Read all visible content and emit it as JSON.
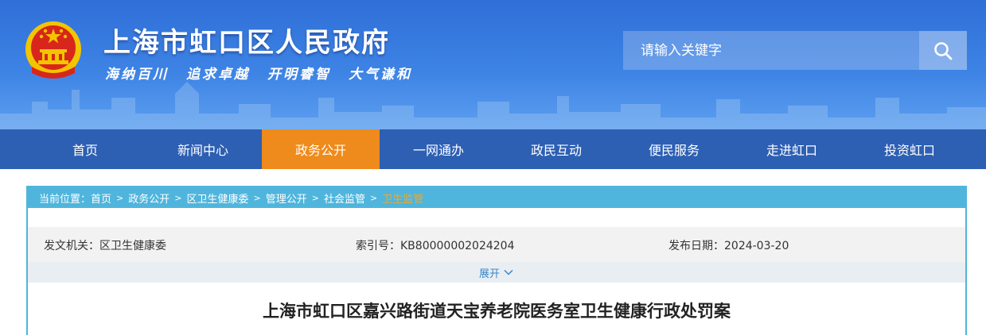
{
  "header": {
    "site_title": "上海市虹口区人民政府",
    "slogans": [
      "海纳百川",
      "追求卓越",
      "开明睿智",
      "大气谦和"
    ],
    "search": {
      "placeholder": "请输入关键字"
    }
  },
  "nav": {
    "items": [
      {
        "label": "首页",
        "active": false
      },
      {
        "label": "新闻中心",
        "active": false
      },
      {
        "label": "政务公开",
        "active": true
      },
      {
        "label": "一网通办",
        "active": false
      },
      {
        "label": "政民互动",
        "active": false
      },
      {
        "label": "便民服务",
        "active": false
      },
      {
        "label": "走进虹口",
        "active": false
      },
      {
        "label": "投资虹口",
        "active": false
      }
    ]
  },
  "breadcrumb": {
    "prefix": "当前位置：",
    "items": [
      "首页",
      "政务公开",
      "区卫生健康委",
      "管理公开",
      "社会监管",
      "卫生监管"
    ]
  },
  "meta": {
    "issuer_label": "发文机关：",
    "issuer": "区卫生健康委",
    "index_label": "索引号：",
    "index": "KB80000002024204",
    "date_label": "发布日期：",
    "date": "2024-03-20"
  },
  "expand_label": "展开",
  "article": {
    "title": "上海市虹口区嘉兴路街道天宝养老院医务室卫生健康行政处罚案"
  },
  "colors": {
    "header_blue": "#3d83e4",
    "nav_blue": "#2d5fb3",
    "nav_active": "#ef8a1c",
    "breadcrumb_bar": "#4fb5dc",
    "current_crumb": "#f5a623"
  }
}
